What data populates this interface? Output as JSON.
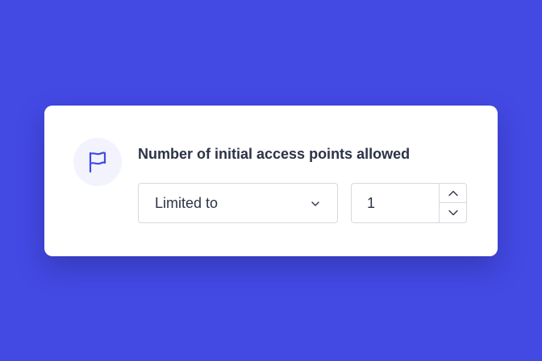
{
  "setting": {
    "title": "Number of initial access points allowed",
    "icon": "flag-icon",
    "limit_select": {
      "selected": "Limited to"
    },
    "limit_value": {
      "value": "1"
    }
  },
  "colors": {
    "background": "#4349e3",
    "card": "#ffffff",
    "accent": "#4349e3",
    "icon_bg": "#f2f3fd",
    "text": "#2c3346",
    "border": "#d6d9e0"
  }
}
